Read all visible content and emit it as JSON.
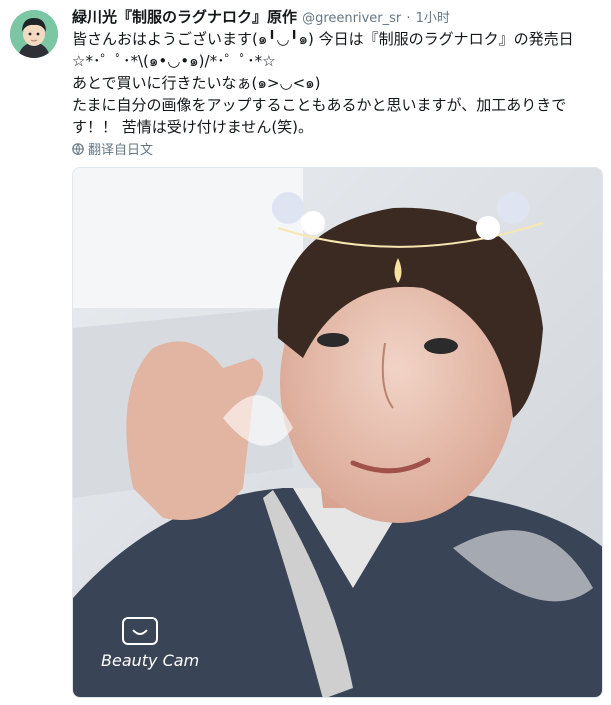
{
  "tweet": {
    "display_name": "緑川光『制服のラグナロク』原作",
    "handle": "@greenriver_sr",
    "separator": "·",
    "time": "1小时",
    "lines": [
      "皆さんおはようございます(๑╹◡╹๑) 今日は『制服のラグナロク』の発売日",
      "☆*･゜ﾟ･*\\(๑•◡•๑)/*･゜ﾟ･*☆",
      "あとで買いに行きたいなぁ(๑>◡<๑)",
      "たまに自分の画像をアップすることもあるかと思いますが、加工ありきで",
      "す！！ 苦情は受け付けません(笑)。"
    ],
    "translate_label": "翻译自日文",
    "photo_watermark": "Beauty Cam"
  },
  "colors": {
    "text": "#14171a",
    "secondary": "#657786",
    "avatar_bg": "#6fbf9a"
  }
}
